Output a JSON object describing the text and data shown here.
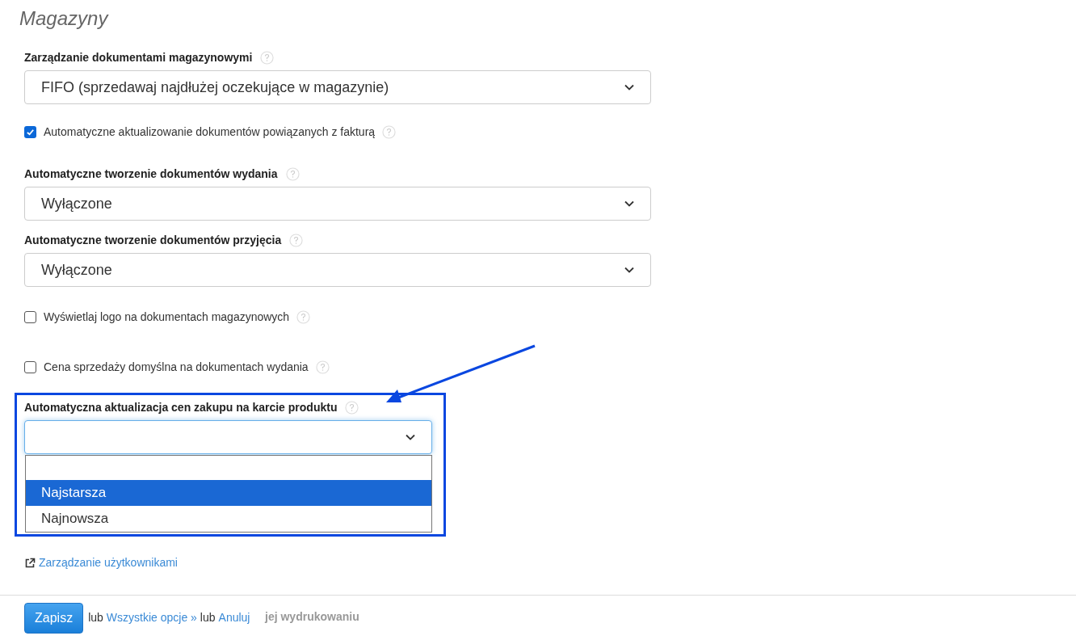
{
  "heading": "Magazyny",
  "fields": [
    {
      "kind": "select",
      "label": "Zarządzanie dokumentami magazynowymi",
      "value": "FIFO (sprzedawaj najdłużej oczekujące w magazynie)",
      "expanded": false
    },
    {
      "kind": "checkbox",
      "label": "Automatyczne aktualizowanie dokumentów powiązanych z fakturą",
      "checked": true
    },
    {
      "kind": "select",
      "label": "Automatyczne tworzenie dokumentów wydania",
      "value": "Wyłączone",
      "expanded": false
    },
    {
      "kind": "select",
      "label": "Automatyczne tworzenie dokumentów przyjęcia",
      "value": "Wyłączone",
      "expanded": false
    },
    {
      "kind": "checkbox",
      "label": "Wyświetlaj logo na dokumentach magazynowych",
      "checked": false
    },
    {
      "kind": "checkbox",
      "label": "Cena sprzedaży domyślna na dokumentach wydania",
      "checked": false
    },
    {
      "kind": "select",
      "label": "Automatyczna aktualizacja cen zakupu na karcie produktu",
      "expanded": true,
      "highlighted": true,
      "options": [
        {
          "label": "Najstarsza",
          "selected": true
        },
        {
          "label": "Najnowsza",
          "selected": false
        }
      ]
    }
  ],
  "users_link": "Zarządzanie użytkownikami",
  "faded_label": "jej wydrukowaniu",
  "footer": {
    "save": "Zapisz",
    "or1": "lub",
    "all_options": "Wszystkie opcje »",
    "or2": "lub",
    "cancel": "Anuluj"
  }
}
